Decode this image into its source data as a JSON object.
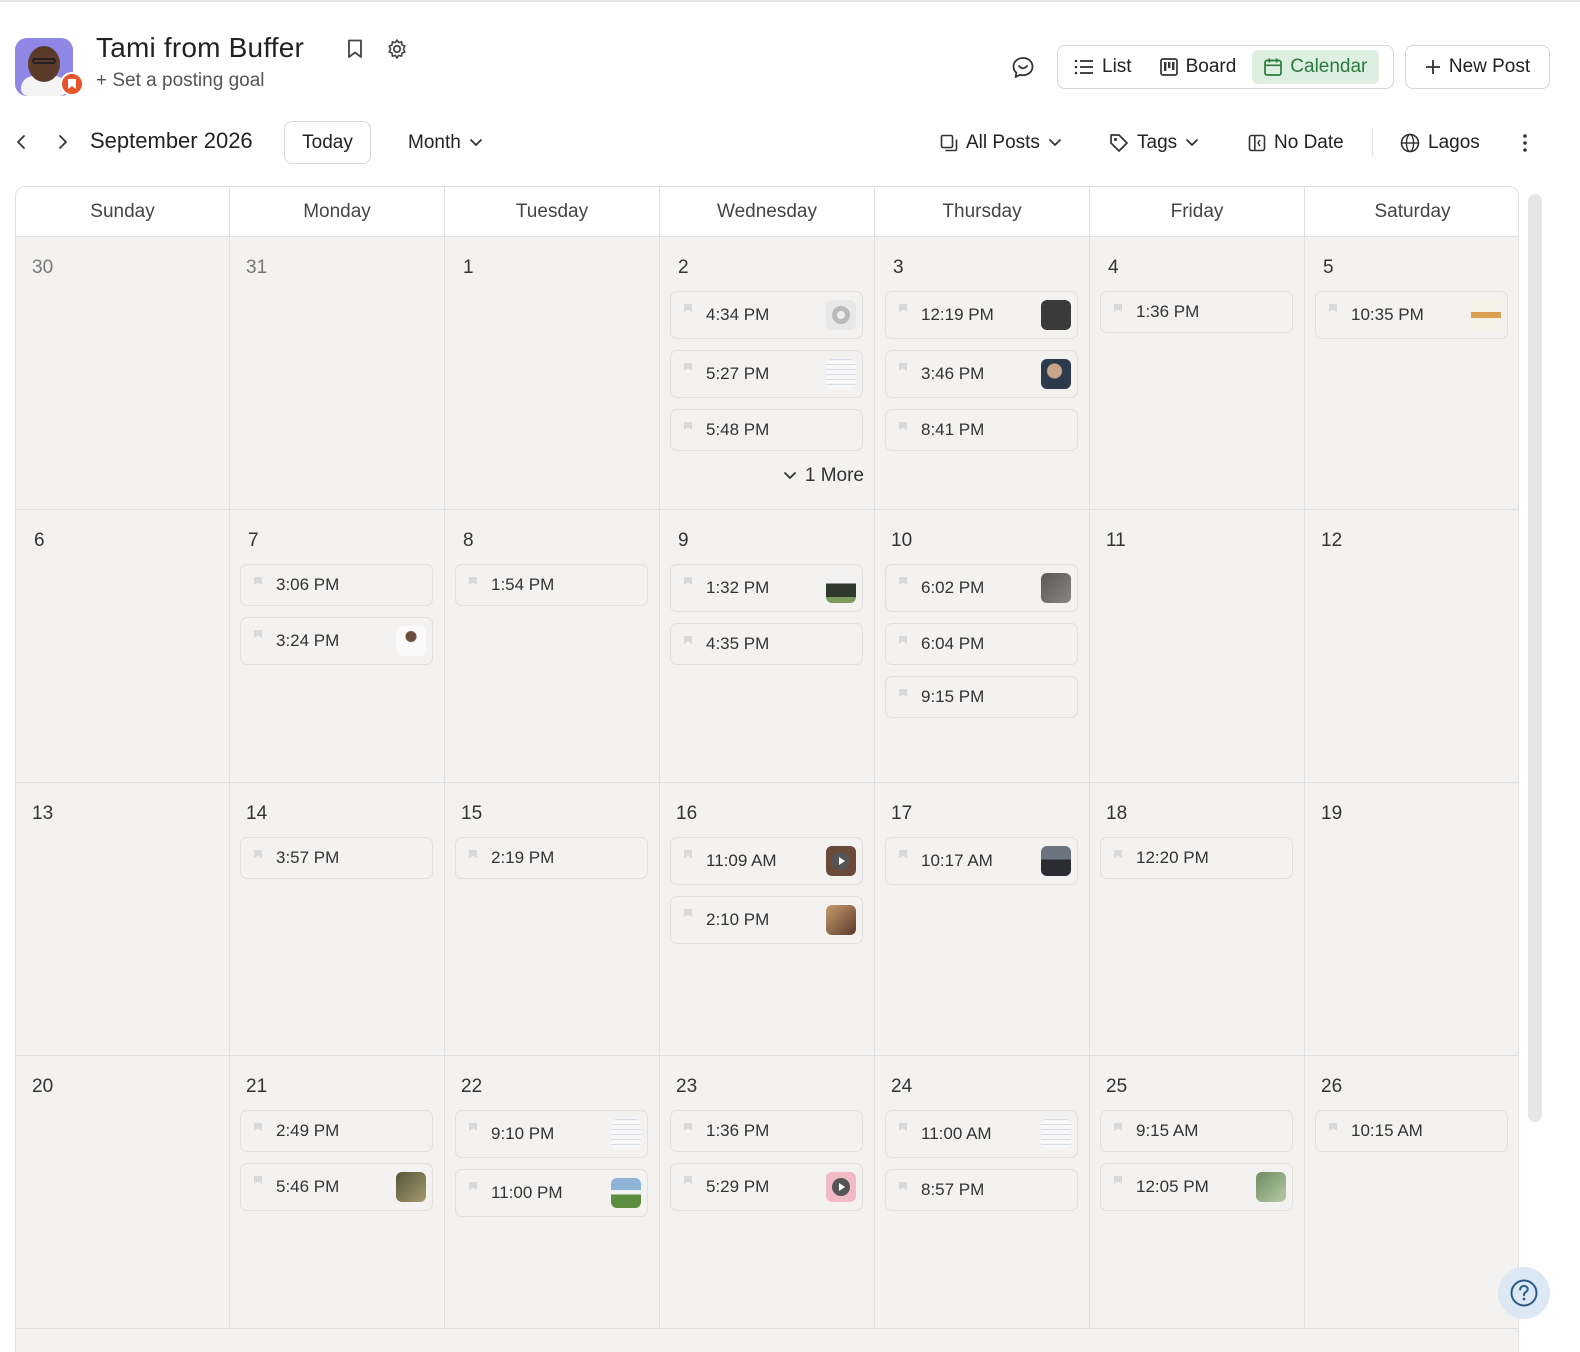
{
  "header": {
    "title": "Tami from Buffer",
    "subtitle": "+ Set a posting goal",
    "views": [
      {
        "label": "List",
        "active": false
      },
      {
        "label": "Board",
        "active": false
      },
      {
        "label": "Calendar",
        "active": true
      }
    ],
    "new_post_label": "New Post"
  },
  "toolbar": {
    "month_label": "September 2026",
    "today_label": "Today",
    "range_label": "Month",
    "filter_label": "All Posts",
    "tags_label": "Tags",
    "nodate_label": "No Date",
    "timezone_label": "Lagos"
  },
  "weekdays": [
    "Sunday",
    "Monday",
    "Tuesday",
    "Wednesday",
    "Thursday",
    "Friday",
    "Saturday"
  ],
  "weeks": [
    [
      {
        "day": "30",
        "muted": true,
        "posts": []
      },
      {
        "day": "31",
        "muted": true,
        "posts": []
      },
      {
        "day": "1",
        "posts": []
      },
      {
        "day": "2",
        "posts": [
          {
            "time": "4:34 PM",
            "thumb": "gear-doc"
          },
          {
            "time": "5:27 PM",
            "thumb": "doc"
          },
          {
            "time": "5:48 PM",
            "thumb": null
          }
        ],
        "more": "1 More"
      },
      {
        "day": "3",
        "posts": [
          {
            "time": "12:19 PM",
            "thumb": "dark"
          },
          {
            "time": "3:46 PM",
            "thumb": "photo-blue"
          },
          {
            "time": "8:41 PM",
            "thumb": null
          }
        ]
      },
      {
        "day": "4",
        "posts": [
          {
            "time": "1:36 PM",
            "thumb": null
          }
        ]
      },
      {
        "day": "5",
        "posts": [
          {
            "time": "10:35 PM",
            "thumb": "people"
          }
        ]
      }
    ],
    [
      {
        "day": "6",
        "posts": []
      },
      {
        "day": "7",
        "posts": [
          {
            "time": "3:06 PM",
            "thumb": null
          },
          {
            "time": "3:24 PM",
            "thumb": "person-white"
          }
        ]
      },
      {
        "day": "8",
        "posts": [
          {
            "time": "1:54 PM",
            "thumb": null
          }
        ]
      },
      {
        "day": "9",
        "posts": [
          {
            "time": "1:32 PM",
            "thumb": "landscape"
          },
          {
            "time": "4:35 PM",
            "thumb": null
          }
        ]
      },
      {
        "day": "10",
        "posts": [
          {
            "time": "6:02 PM",
            "thumb": "photo-gray"
          },
          {
            "time": "6:04 PM",
            "thumb": null
          },
          {
            "time": "9:15 PM",
            "thumb": null
          }
        ]
      },
      {
        "day": "11",
        "posts": []
      },
      {
        "day": "12",
        "posts": []
      }
    ],
    [
      {
        "day": "13",
        "posts": []
      },
      {
        "day": "14",
        "posts": [
          {
            "time": "3:57 PM",
            "thumb": null
          }
        ]
      },
      {
        "day": "15",
        "posts": [
          {
            "time": "2:19 PM",
            "thumb": null
          }
        ]
      },
      {
        "day": "16",
        "posts": [
          {
            "time": "11:09 AM",
            "thumb": "video-brown"
          },
          {
            "time": "2:10 PM",
            "thumb": "photo-warm"
          }
        ]
      },
      {
        "day": "17",
        "posts": [
          {
            "time": "10:17 AM",
            "thumb": "photo-dark"
          }
        ]
      },
      {
        "day": "18",
        "posts": [
          {
            "time": "12:20 PM",
            "thumb": null
          }
        ]
      },
      {
        "day": "19",
        "posts": []
      }
    ],
    [
      {
        "day": "20",
        "posts": []
      },
      {
        "day": "21",
        "posts": [
          {
            "time": "2:49 PM",
            "thumb": null
          },
          {
            "time": "5:46 PM",
            "thumb": "photo-olive"
          }
        ]
      },
      {
        "day": "22",
        "posts": [
          {
            "time": "9:10 PM",
            "thumb": "doc"
          },
          {
            "time": "11:00 PM",
            "thumb": "landscape-green"
          }
        ]
      },
      {
        "day": "23",
        "posts": [
          {
            "time": "1:36 PM",
            "thumb": null
          },
          {
            "time": "5:29 PM",
            "thumb": "video-pink"
          }
        ]
      },
      {
        "day": "24",
        "posts": [
          {
            "time": "11:00 AM",
            "thumb": "doc"
          },
          {
            "time": "8:57 PM",
            "thumb": null
          }
        ]
      },
      {
        "day": "25",
        "posts": [
          {
            "time": "9:15 AM",
            "thumb": null
          },
          {
            "time": "12:05 PM",
            "thumb": "photo-green"
          }
        ]
      },
      {
        "day": "26",
        "posts": [
          {
            "time": "10:15 AM",
            "thumb": null
          }
        ]
      }
    ]
  ],
  "colors": {
    "accent_green_bg": "#dcefe0",
    "accent_green_text": "#2c7a3f",
    "badge_orange": "#e8542c",
    "cell_bg": "#f3f2f0"
  },
  "icons": {
    "header": [
      "bookmark-icon",
      "gear-icon",
      "feedback-icon"
    ],
    "toolbar": [
      "chevron-left-icon",
      "chevron-right-icon",
      "copy-icon",
      "tag-icon",
      "no-date-icon",
      "globe-icon",
      "kebab-icon"
    ],
    "help": "help-icon"
  }
}
